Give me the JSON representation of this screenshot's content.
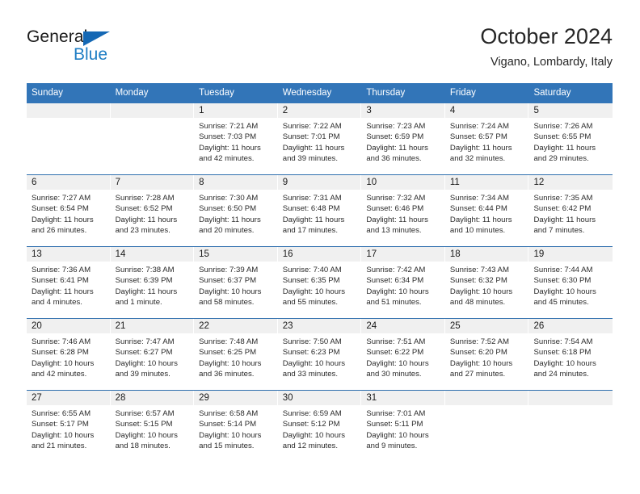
{
  "brand": {
    "name_top": "General",
    "name_bottom": "Blue",
    "triangle_color": "#1568b4",
    "blue_text_color": "#1f7ec4"
  },
  "header": {
    "title": "October 2024",
    "subtitle": "Vigano, Lombardy, Italy"
  },
  "colors": {
    "header_blue": "#3275b8",
    "row_divider_blue": "#2f6fae",
    "day_number_band": "#f0f0f0",
    "cell_background": "#ffffff",
    "text": "#2b2b2b"
  },
  "weekday_headers": [
    "Sunday",
    "Monday",
    "Tuesday",
    "Wednesday",
    "Thursday",
    "Friday",
    "Saturday"
  ],
  "labels": {
    "sunrise_prefix": "Sunrise:",
    "sunset_prefix": "Sunset:",
    "daylight_prefix": "Daylight:"
  },
  "weeks": [
    [
      {
        "day": "",
        "empty": true,
        "sunrise": "",
        "sunset": "",
        "daylight_line1": "",
        "daylight_line2": ""
      },
      {
        "day": "",
        "empty": true,
        "sunrise": "",
        "sunset": "",
        "daylight_line1": "",
        "daylight_line2": ""
      },
      {
        "day": "1",
        "empty": false,
        "sunrise": "Sunrise: 7:21 AM",
        "sunset": "Sunset: 7:03 PM",
        "daylight_line1": "Daylight: 11 hours",
        "daylight_line2": "and 42 minutes."
      },
      {
        "day": "2",
        "empty": false,
        "sunrise": "Sunrise: 7:22 AM",
        "sunset": "Sunset: 7:01 PM",
        "daylight_line1": "Daylight: 11 hours",
        "daylight_line2": "and 39 minutes."
      },
      {
        "day": "3",
        "empty": false,
        "sunrise": "Sunrise: 7:23 AM",
        "sunset": "Sunset: 6:59 PM",
        "daylight_line1": "Daylight: 11 hours",
        "daylight_line2": "and 36 minutes."
      },
      {
        "day": "4",
        "empty": false,
        "sunrise": "Sunrise: 7:24 AM",
        "sunset": "Sunset: 6:57 PM",
        "daylight_line1": "Daylight: 11 hours",
        "daylight_line2": "and 32 minutes."
      },
      {
        "day": "5",
        "empty": false,
        "sunrise": "Sunrise: 7:26 AM",
        "sunset": "Sunset: 6:55 PM",
        "daylight_line1": "Daylight: 11 hours",
        "daylight_line2": "and 29 minutes."
      }
    ],
    [
      {
        "day": "6",
        "empty": false,
        "sunrise": "Sunrise: 7:27 AM",
        "sunset": "Sunset: 6:54 PM",
        "daylight_line1": "Daylight: 11 hours",
        "daylight_line2": "and 26 minutes."
      },
      {
        "day": "7",
        "empty": false,
        "sunrise": "Sunrise: 7:28 AM",
        "sunset": "Sunset: 6:52 PM",
        "daylight_line1": "Daylight: 11 hours",
        "daylight_line2": "and 23 minutes."
      },
      {
        "day": "8",
        "empty": false,
        "sunrise": "Sunrise: 7:30 AM",
        "sunset": "Sunset: 6:50 PM",
        "daylight_line1": "Daylight: 11 hours",
        "daylight_line2": "and 20 minutes."
      },
      {
        "day": "9",
        "empty": false,
        "sunrise": "Sunrise: 7:31 AM",
        "sunset": "Sunset: 6:48 PM",
        "daylight_line1": "Daylight: 11 hours",
        "daylight_line2": "and 17 minutes."
      },
      {
        "day": "10",
        "empty": false,
        "sunrise": "Sunrise: 7:32 AM",
        "sunset": "Sunset: 6:46 PM",
        "daylight_line1": "Daylight: 11 hours",
        "daylight_line2": "and 13 minutes."
      },
      {
        "day": "11",
        "empty": false,
        "sunrise": "Sunrise: 7:34 AM",
        "sunset": "Sunset: 6:44 PM",
        "daylight_line1": "Daylight: 11 hours",
        "daylight_line2": "and 10 minutes."
      },
      {
        "day": "12",
        "empty": false,
        "sunrise": "Sunrise: 7:35 AM",
        "sunset": "Sunset: 6:42 PM",
        "daylight_line1": "Daylight: 11 hours",
        "daylight_line2": "and 7 minutes."
      }
    ],
    [
      {
        "day": "13",
        "empty": false,
        "sunrise": "Sunrise: 7:36 AM",
        "sunset": "Sunset: 6:41 PM",
        "daylight_line1": "Daylight: 11 hours",
        "daylight_line2": "and 4 minutes."
      },
      {
        "day": "14",
        "empty": false,
        "sunrise": "Sunrise: 7:38 AM",
        "sunset": "Sunset: 6:39 PM",
        "daylight_line1": "Daylight: 11 hours",
        "daylight_line2": "and 1 minute."
      },
      {
        "day": "15",
        "empty": false,
        "sunrise": "Sunrise: 7:39 AM",
        "sunset": "Sunset: 6:37 PM",
        "daylight_line1": "Daylight: 10 hours",
        "daylight_line2": "and 58 minutes."
      },
      {
        "day": "16",
        "empty": false,
        "sunrise": "Sunrise: 7:40 AM",
        "sunset": "Sunset: 6:35 PM",
        "daylight_line1": "Daylight: 10 hours",
        "daylight_line2": "and 55 minutes."
      },
      {
        "day": "17",
        "empty": false,
        "sunrise": "Sunrise: 7:42 AM",
        "sunset": "Sunset: 6:34 PM",
        "daylight_line1": "Daylight: 10 hours",
        "daylight_line2": "and 51 minutes."
      },
      {
        "day": "18",
        "empty": false,
        "sunrise": "Sunrise: 7:43 AM",
        "sunset": "Sunset: 6:32 PM",
        "daylight_line1": "Daylight: 10 hours",
        "daylight_line2": "and 48 minutes."
      },
      {
        "day": "19",
        "empty": false,
        "sunrise": "Sunrise: 7:44 AM",
        "sunset": "Sunset: 6:30 PM",
        "daylight_line1": "Daylight: 10 hours",
        "daylight_line2": "and 45 minutes."
      }
    ],
    [
      {
        "day": "20",
        "empty": false,
        "sunrise": "Sunrise: 7:46 AM",
        "sunset": "Sunset: 6:28 PM",
        "daylight_line1": "Daylight: 10 hours",
        "daylight_line2": "and 42 minutes."
      },
      {
        "day": "21",
        "empty": false,
        "sunrise": "Sunrise: 7:47 AM",
        "sunset": "Sunset: 6:27 PM",
        "daylight_line1": "Daylight: 10 hours",
        "daylight_line2": "and 39 minutes."
      },
      {
        "day": "22",
        "empty": false,
        "sunrise": "Sunrise: 7:48 AM",
        "sunset": "Sunset: 6:25 PM",
        "daylight_line1": "Daylight: 10 hours",
        "daylight_line2": "and 36 minutes."
      },
      {
        "day": "23",
        "empty": false,
        "sunrise": "Sunrise: 7:50 AM",
        "sunset": "Sunset: 6:23 PM",
        "daylight_line1": "Daylight: 10 hours",
        "daylight_line2": "and 33 minutes."
      },
      {
        "day": "24",
        "empty": false,
        "sunrise": "Sunrise: 7:51 AM",
        "sunset": "Sunset: 6:22 PM",
        "daylight_line1": "Daylight: 10 hours",
        "daylight_line2": "and 30 minutes."
      },
      {
        "day": "25",
        "empty": false,
        "sunrise": "Sunrise: 7:52 AM",
        "sunset": "Sunset: 6:20 PM",
        "daylight_line1": "Daylight: 10 hours",
        "daylight_line2": "and 27 minutes."
      },
      {
        "day": "26",
        "empty": false,
        "sunrise": "Sunrise: 7:54 AM",
        "sunset": "Sunset: 6:18 PM",
        "daylight_line1": "Daylight: 10 hours",
        "daylight_line2": "and 24 minutes."
      }
    ],
    [
      {
        "day": "27",
        "empty": false,
        "sunrise": "Sunrise: 6:55 AM",
        "sunset": "Sunset: 5:17 PM",
        "daylight_line1": "Daylight: 10 hours",
        "daylight_line2": "and 21 minutes."
      },
      {
        "day": "28",
        "empty": false,
        "sunrise": "Sunrise: 6:57 AM",
        "sunset": "Sunset: 5:15 PM",
        "daylight_line1": "Daylight: 10 hours",
        "daylight_line2": "and 18 minutes."
      },
      {
        "day": "29",
        "empty": false,
        "sunrise": "Sunrise: 6:58 AM",
        "sunset": "Sunset: 5:14 PM",
        "daylight_line1": "Daylight: 10 hours",
        "daylight_line2": "and 15 minutes."
      },
      {
        "day": "30",
        "empty": false,
        "sunrise": "Sunrise: 6:59 AM",
        "sunset": "Sunset: 5:12 PM",
        "daylight_line1": "Daylight: 10 hours",
        "daylight_line2": "and 12 minutes."
      },
      {
        "day": "31",
        "empty": false,
        "sunrise": "Sunrise: 7:01 AM",
        "sunset": "Sunset: 5:11 PM",
        "daylight_line1": "Daylight: 10 hours",
        "daylight_line2": "and 9 minutes."
      },
      {
        "day": "",
        "empty": true,
        "sunrise": "",
        "sunset": "",
        "daylight_line1": "",
        "daylight_line2": ""
      },
      {
        "day": "",
        "empty": true,
        "sunrise": "",
        "sunset": "",
        "daylight_line1": "",
        "daylight_line2": ""
      }
    ]
  ]
}
